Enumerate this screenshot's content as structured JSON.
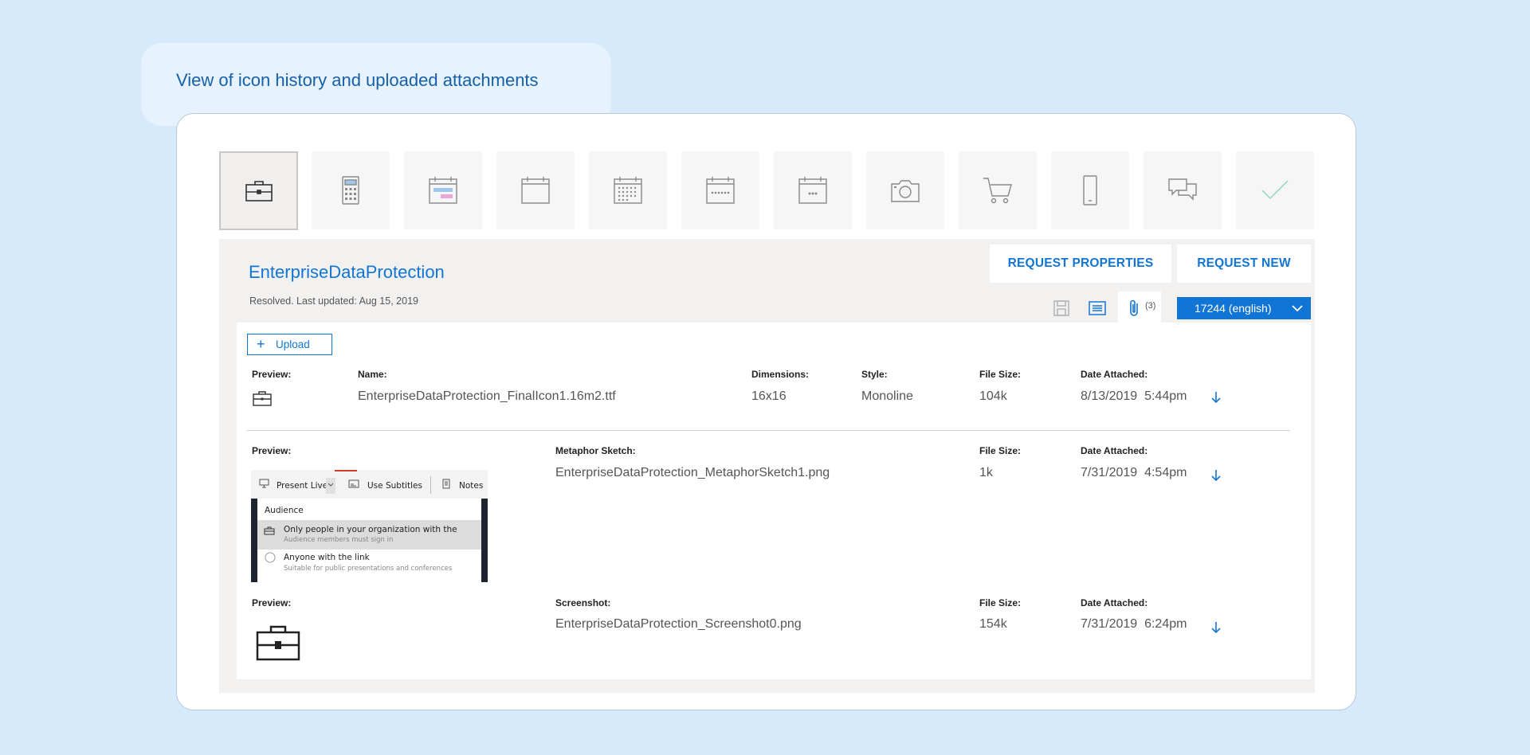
{
  "caption": "View of icon history and uploaded attachments",
  "icon_strip": [
    {
      "name": "briefcase-icon",
      "selected": true
    },
    {
      "name": "calculator-icon",
      "selected": false
    },
    {
      "name": "calendar-colored-icon",
      "selected": false
    },
    {
      "name": "calendar-blank-icon",
      "selected": false
    },
    {
      "name": "calendar-grid-icon",
      "selected": false
    },
    {
      "name": "calendar-dots-row-icon",
      "selected": false
    },
    {
      "name": "calendar-three-dots-icon",
      "selected": false
    },
    {
      "name": "camera-icon",
      "selected": false
    },
    {
      "name": "cart-icon",
      "selected": false
    },
    {
      "name": "phone-icon",
      "selected": false
    },
    {
      "name": "chat-bubbles-icon",
      "selected": false
    },
    {
      "name": "checkmark-icon",
      "selected": false
    }
  ],
  "panel": {
    "title": "EnterpriseDataProtection",
    "status": "Resolved.  Last updated: Aug 15, 2019",
    "request_properties": "REQUEST PROPERTIES",
    "request_new": "REQUEST NEW",
    "attachment_count": "(3)",
    "language": "17244 (english)",
    "upload_label": "Upload"
  },
  "attachments": [
    {
      "preview_label": "Preview:",
      "name_label": "Name:",
      "name": "EnterpriseDataProtection_FinalIcon1.16m2.ttf",
      "dimensions_label": "Dimensions:",
      "dimensions": "16x16",
      "style_label": "Style:",
      "style": "Monoline",
      "size_label": "File Size:",
      "size": "104k",
      "date_label": "Date Attached:",
      "date": "8/13/2019  5:44pm"
    },
    {
      "preview_label": "Preview:",
      "name_label": "Metaphor Sketch:",
      "name": "EnterpriseDataProtection_MetaphorSketch1.png",
      "size_label": "File Size:",
      "size": "1k",
      "date_label": "Date Attached:",
      "date": "7/31/2019  4:54pm"
    },
    {
      "preview_label": "Preview:",
      "name_label": "Screenshot:",
      "name": "EnterpriseDataProtection_Screenshot0.png",
      "size_label": "File Size:",
      "size": "154k",
      "date_label": "Date Attached:",
      "date": "7/31/2019  6:24pm"
    }
  ],
  "sketch_preview": {
    "present_live": "Present Live",
    "use_subtitles": "Use Subtitles",
    "notes": "Notes",
    "audience": "Audience",
    "option1_title": "Only people in your organization with the",
    "option1_sub": "Audience members must sign in",
    "option2_title": "Anyone with the link",
    "option2_sub": "Suitable for public presentations and conferences"
  },
  "colors": {
    "background": "#d6eafb",
    "accent": "#1175d6",
    "panel": "#f2f1f0"
  }
}
